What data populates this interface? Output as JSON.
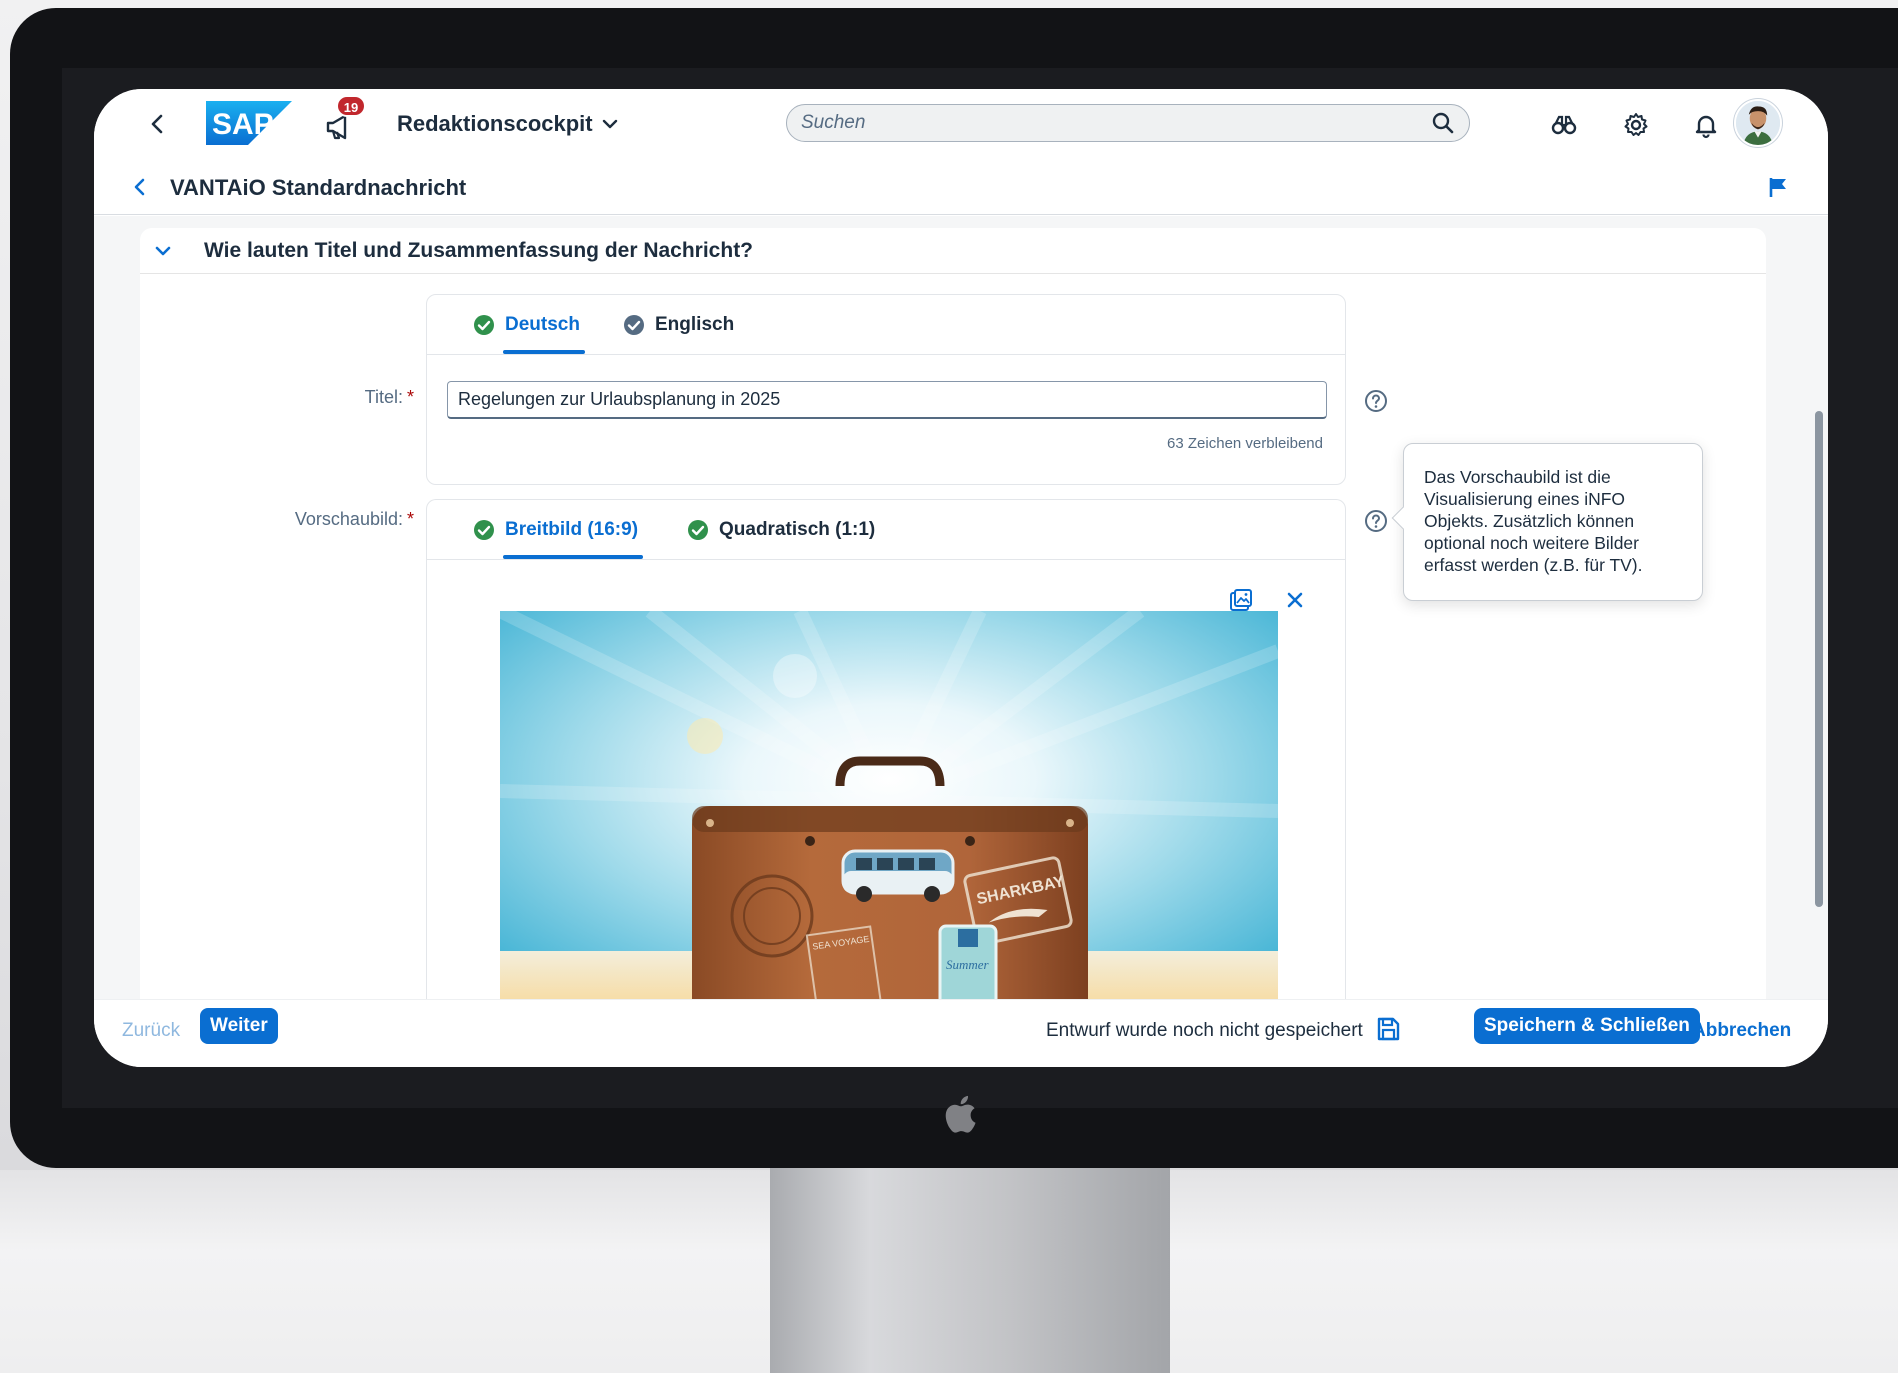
{
  "shellbar": {
    "logo_text": "SAP",
    "notification_count": "19",
    "app_title": "Redaktionscockpit",
    "search_placeholder": "Suchen",
    "icons": [
      "back-icon",
      "megaphone-icon",
      "chevron-down-icon",
      "search-icon",
      "binoculars-icon",
      "gear-icon",
      "bell-icon",
      "avatar"
    ]
  },
  "subheader": {
    "title": "VANTAiO Standardnachricht"
  },
  "section": {
    "title": "Wie lauten Titel und Zusammenfassung der Nachricht?"
  },
  "language_tabs": [
    {
      "label": "Deutsch",
      "status": "complete",
      "active": true
    },
    {
      "label": "Englisch",
      "status": "complete",
      "active": false
    }
  ],
  "title_field": {
    "label": "Titel:",
    "required_mark": "*",
    "value": "Regelungen zur Urlaubsplanung in 2025",
    "counter": "63 Zeichen verbleibend"
  },
  "preview_field": {
    "label": "Vorschaubild:",
    "required_mark": "*",
    "tabs": [
      {
        "label": "Breitbild (16:9)",
        "status": "complete",
        "active": true
      },
      {
        "label": "Quadratisch (1:1)",
        "status": "complete",
        "active": false
      }
    ],
    "image_stickers": [
      "SHARKBAY",
      "SEA VOYAGE",
      "Summer"
    ]
  },
  "help_popover": {
    "text": "Das Vorschaubild ist die Visualisierung eines iNFO Objekts. Zusätzlich können optional noch weitere Bilder erfasst werden (z.B. für TV)."
  },
  "footer": {
    "back_label": "Zurück",
    "next_label": "Weiter",
    "draft_status": "Entwurf wurde noch nicht gespeichert",
    "save_close_label": "Speichern & Schließen",
    "cancel_label": "Abbrechen"
  },
  "colors": {
    "accent": "#0a6ed1",
    "text": "#1d2d3e",
    "badge": "#c1272d",
    "success": "#30914c",
    "required": "#aa0808"
  }
}
